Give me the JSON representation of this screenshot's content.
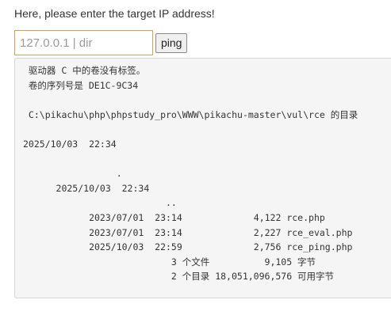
{
  "form": {
    "prompt": "Here, please enter the target IP address!",
    "ip_input_value": "",
    "ip_input_placeholder": "127.0.0.1 | dir",
    "submit_label": "ping"
  },
  "output": {
    "lines": [
      " 驱动器 C 中的卷没有标签。",
      " 卷的序列号是 DE1C-9C34",
      "",
      " C:\\pikachu\\php\\phpstudy_pro\\WWW\\pikachu-master\\vul\\rce 的目录",
      "",
      "2025/10/03  22:34",
      "",
      "                 .",
      "      2025/10/03  22:34",
      "                          ..",
      "            2023/07/01  23:14             4,122 rce.php",
      "            2023/07/01  23:14             2,227 rce_eval.php",
      "            2025/10/03  22:59             2,756 rce_ping.php",
      "                           3 个文件          9,105 字节",
      "                           2 个目录 18,051,096,576 可用字节"
    ]
  }
}
